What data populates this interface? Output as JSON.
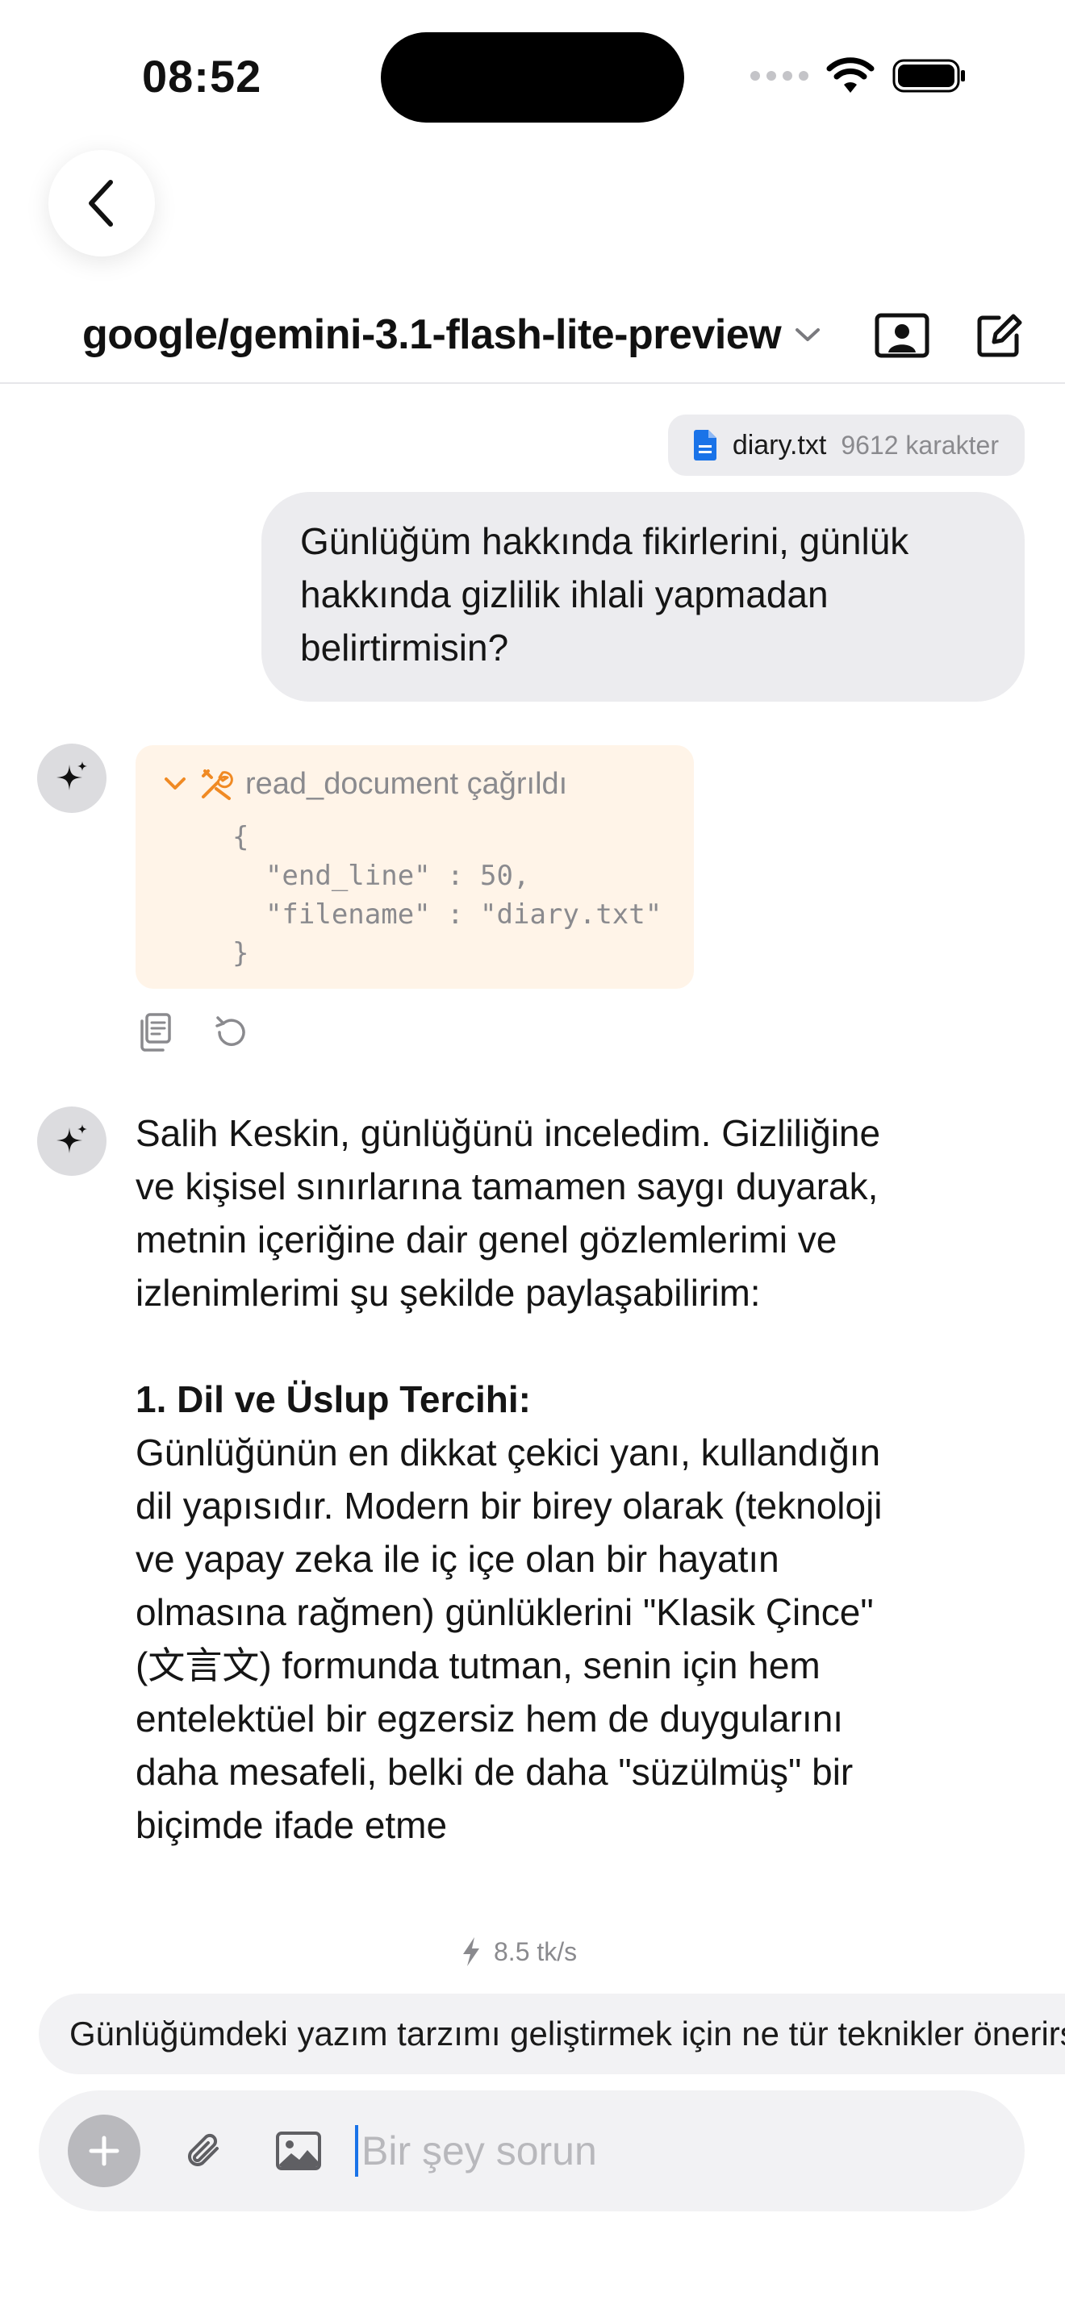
{
  "status_bar": {
    "time": "08:52"
  },
  "header": {
    "model_name": "google/gemini-3.1-flash-lite-preview",
    "icons": {
      "back": "chevron-left-icon",
      "dropdown": "chevron-down-icon",
      "profile": "person-card-icon",
      "new_chat": "compose-icon"
    }
  },
  "attachment": {
    "filename": "diary.txt",
    "size": "9612 karakter",
    "icon": "document-icon",
    "icon_color": "#1a73e8"
  },
  "user_message": {
    "text": "Günlüğüm hakkında fikirlerini, günlük hakkında gizlilik ihlali yapmadan belirtirmisin?"
  },
  "tool_call": {
    "title": "read_document çağrıldı",
    "json_lines": [
      "{",
      "  \"end_line\" : 50,",
      "  \"filename\" : \"diary.txt\"",
      "}"
    ],
    "accent_color": "#f08a24"
  },
  "assistant_message": {
    "intro": "Salih Keskin, günlüğünü inceledim. Gizliliğine ve kişisel sınırlarına tamamen saygı duyarak, metnin içeriğine dair genel gözlemlerimi ve izlenimlerimi şu şekilde paylaşabilirim:",
    "heading_1": "1. Dil ve Üslup Tercihi:",
    "paragraph_1": "Günlüğünün en dikkat çekici yanı, kullandığın dil yapısıdır. Modern bir birey olarak (teknoloji ve yapay zeka ile iç içe olan bir hayatın olmasına rağmen) günlüklerini \"Klasik Çince\" (文言文) formunda tutman, senin için hem entelektüel bir egzersiz hem de duygularını daha mesafeli, belki de daha \"süzülmüş\" bir biçimde ifade etme"
  },
  "generation_speed": "8.5 tk/s",
  "suggestion": "Günlüğümdeki yazım tarzımı geliştirmek için ne tür teknikler önerirsin?",
  "composer": {
    "placeholder": "Bir şey sorun"
  }
}
